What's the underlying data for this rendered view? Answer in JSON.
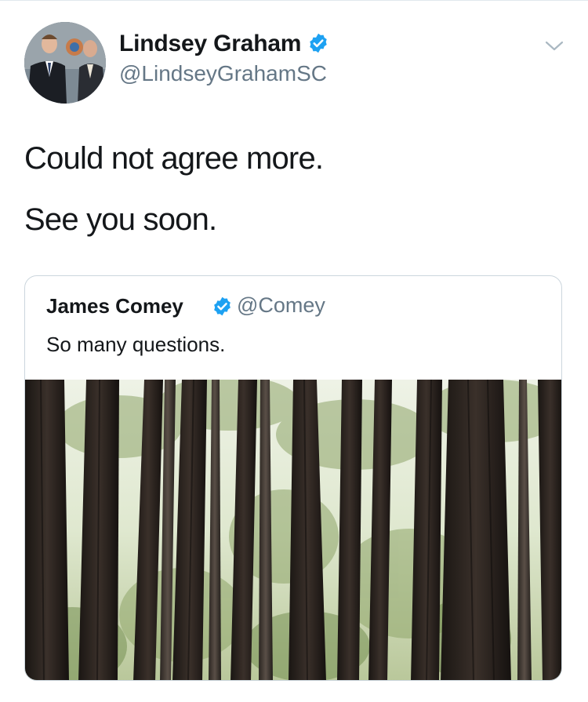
{
  "tweet": {
    "author": {
      "name": "Lindsey Graham",
      "handle": "@LindseyGrahamSC",
      "avatar_icon": "profile-photo",
      "verified_icon": "verified-badge-icon"
    },
    "menu_icon": "chevron-down-icon",
    "text_lines": [
      "Could not agree more.",
      "See you soon."
    ]
  },
  "quoted_tweet": {
    "author": {
      "name": "James Comey",
      "handle": "@Comey",
      "verified_icon": "verified-badge-icon"
    },
    "text": "So many questions.",
    "media_icon": "photo-redwood-forest"
  },
  "colors": {
    "text_primary": "#14171a",
    "text_secondary": "#657786",
    "verified_blue": "#1da1f2",
    "border": "#ccd6dd"
  }
}
